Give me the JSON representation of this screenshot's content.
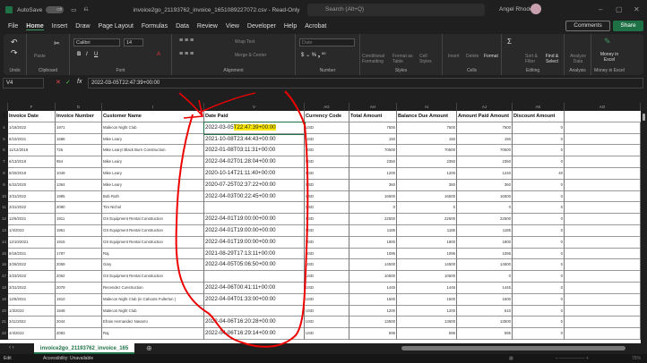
{
  "titlebar": {
    "autosave": "AutoSave",
    "toggle": "Off",
    "filename": "invoice2go_21193762_invoice_1651089227072.csv  -  Read-Only",
    "search_placeholder": "Search (Alt+Q)",
    "user": "Angel Rhodes"
  },
  "menu": [
    "File",
    "Home",
    "Insert",
    "Draw",
    "Page Layout",
    "Formulas",
    "Data",
    "Review",
    "View",
    "Developer",
    "Help",
    "Acrobat"
  ],
  "buttons": {
    "comments": "Comments",
    "share": "Share"
  },
  "ribbon": {
    "font_name": "Calibri",
    "font_size": "14",
    "number_format": "Date",
    "wrap_text": "Wrap Text",
    "merge_center": "Merge & Center",
    "paste": "Paste",
    "conditional": "Conditional Formatting",
    "format_table": "Format as Table",
    "cell_styles": "Cell Styles",
    "insert": "Insert",
    "delete": "Delete",
    "format": "Format",
    "sort_filter": "Sort & Filter",
    "find_select": "Find & Select",
    "analyze": "Analyze Data",
    "money": "Money in Excel",
    "groups": [
      "Undo",
      "Clipboard",
      "Font",
      "Alignment",
      "Number",
      "Styles",
      "Cells",
      "Editing",
      "Analysis",
      "Money in Excel"
    ]
  },
  "formula": {
    "cell_ref": "V4",
    "fx": "fx",
    "value": "2022-03-05T22:47:39+00:00"
  },
  "columns": [
    "F",
    "G",
    "I",
    "V",
    "AG",
    "AH",
    "AI",
    "AJ",
    "AK",
    "AO"
  ],
  "headers": [
    "Invoice Date",
    "Invoice Number",
    "Customer Name",
    "Date Paid",
    "Currency Code",
    "Total Amount",
    "Balance Due Amount",
    "Amount Paid Amount",
    "Discount Amount"
  ],
  "rows": [
    [
      "4",
      "1/18/2022",
      "1971",
      "Malecon Night Club",
      "2022-03-05T22:47:39+00:00",
      "USD",
      "7500",
      "7500",
      "7500",
      "0"
    ],
    [
      "5",
      "6/10/2021",
      "1688",
      "Mike Leary",
      "2021-10-08T23:44:43+00:00",
      "USD",
      "150",
      "150",
      "150",
      "0"
    ],
    [
      "6",
      "11/12/2018",
      "726",
      "Mike Leary/ Black Burn Construction",
      "2022-01-08T03:11:31+00:00",
      "USD",
      "70500",
      "70500",
      "70500",
      "0"
    ],
    [
      "7",
      "6/13/2019",
      "954",
      "Mike Leary",
      "2022-04-02T01:28:04+00:00",
      "USD",
      "2350",
      "2350",
      "2350",
      "0"
    ],
    [
      "8",
      "8/20/2019",
      "1049",
      "Mike Leary",
      "2020-10-14T21:11:40+00:00",
      "USD",
      "1200",
      "1200",
      "1240",
      "40"
    ],
    [
      "9",
      "6/22/2020",
      "1364",
      "Mike Leary",
      "2020-07-25T02:37:22+00:00",
      "USD",
      "360",
      "360",
      "360",
      "0"
    ],
    [
      "10",
      "3/31/2022",
      "1985",
      "Bob Ruth",
      "2022-04-03T00:22:45+00:00",
      "USD",
      "16500",
      "16500",
      "16500",
      "0"
    ],
    [
      "11",
      "3/31/2022",
      "2080",
      "Tim Nichol",
      "",
      "USD",
      "0",
      "0",
      "0",
      "0"
    ],
    [
      "12",
      "12/8/2021",
      "1911",
      "GS Equipment Rental Construction",
      "2022-04-01T19:00:00+00:00",
      "USD",
      "22500",
      "22500",
      "22500",
      "0"
    ],
    [
      "13",
      "1/4/2022",
      "1951",
      "GS Equipment Rental Construction",
      "2022-04-01T19:00:00+00:00",
      "USD",
      "1185",
      "1185",
      "1185",
      "0"
    ],
    [
      "14",
      "12/10/2021",
      "1915",
      "GS Equipment Rental Construction",
      "2022-04-01T19:00:00+00:00",
      "USD",
      "1800",
      "1800",
      "1800",
      "0"
    ],
    [
      "15",
      "8/18/2021",
      "1787",
      "Raj",
      "2021-08-29T17:13:11+00:00",
      "USD",
      "1095",
      "1095",
      "1095",
      "0"
    ],
    [
      "16",
      "3/28/2022",
      "2069",
      "Gary",
      "2022-04-05T05:06:50+00:00",
      "USD",
      "14500",
      "14500",
      "14500",
      "0"
    ],
    [
      "17",
      "3/23/2022",
      "2062",
      "GS Equipment Rental Construction",
      "",
      "USD",
      "10500",
      "10500",
      "0",
      "0"
    ],
    [
      "18",
      "3/31/2022",
      "2079",
      "Recendez Construction",
      "2022-04-06T00:41:11+00:00",
      "USD",
      "1445",
      "1445",
      "1445",
      "0"
    ],
    [
      "19",
      "12/8/2021",
      "1910",
      "Malecon Night Club (in Cahoots Fullerton )",
      "2022-04-04T01:33:00+00:00",
      "USD",
      "1500",
      "1500",
      "1500",
      "0"
    ],
    [
      "20",
      "1/3/2022",
      "1948",
      "Malecon Night Club",
      "",
      "USD",
      "1200",
      "1200",
      "610",
      "0"
    ],
    [
      "21",
      "3/11/2022",
      "2044",
      "Efrain Hernandez Navarro",
      "2022-04-06T16:20:28+00:00",
      "USD",
      "13500",
      "13500",
      "13500",
      "0"
    ],
    [
      "22",
      "4/4/2022",
      "2083",
      "Raj",
      "2022-04-06T16:29:14+00:00",
      "USD",
      "595",
      "595",
      "595",
      "0"
    ]
  ],
  "highlight_part": "T22:47:39+00:00",
  "sheet_tab": "invoice2go_21193762_invoice_165",
  "status": {
    "mode": "Edit",
    "accessibility": "Accessibility: Unavailable",
    "zoom": "75%"
  }
}
